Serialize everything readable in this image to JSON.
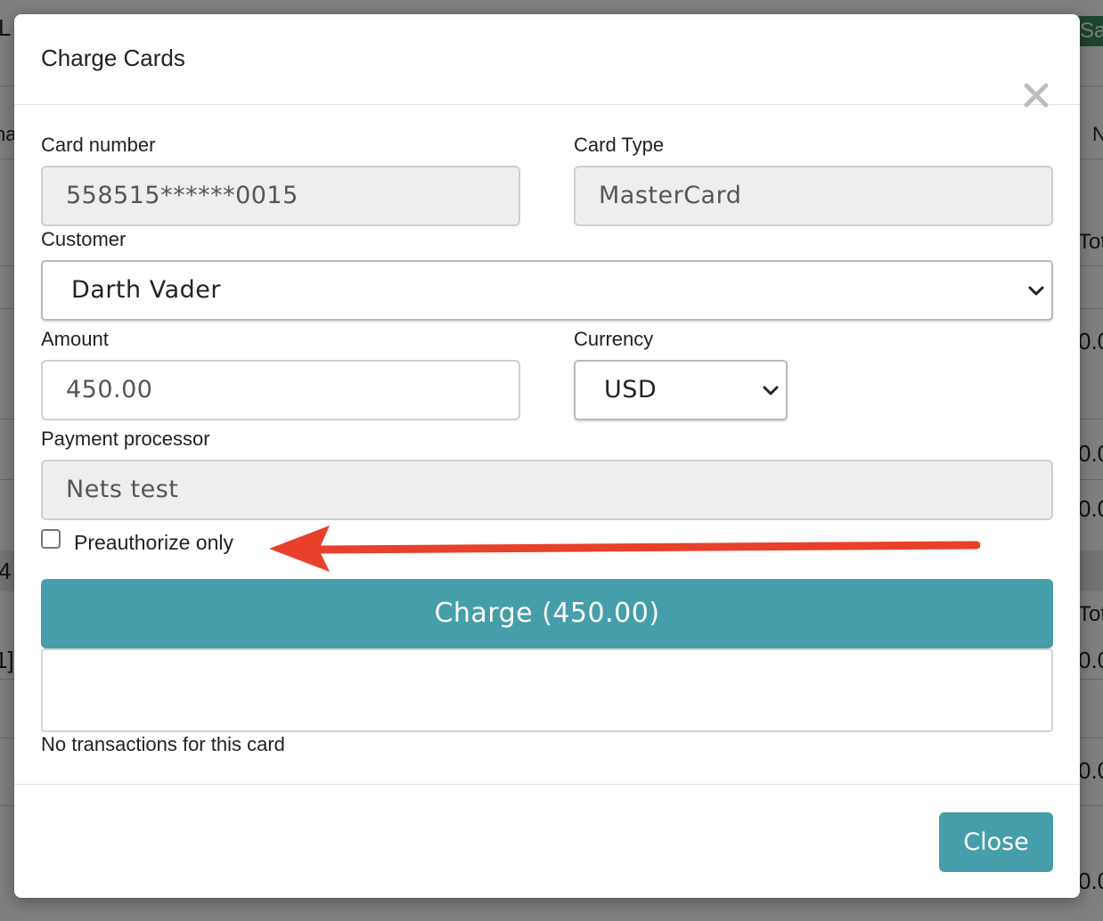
{
  "background": {
    "fragments": [
      "L",
      "na",
      "N",
      "Tot",
      "0.0",
      "0.0",
      "0.0",
      "4",
      "Tot",
      "1]",
      "0.0",
      "0.0",
      "0.0"
    ],
    "save_label": "Sav"
  },
  "modal": {
    "title": "Charge Cards",
    "close_icon": "close-x-icon",
    "card_number": {
      "label": "Card number",
      "value": "558515******0015"
    },
    "card_type": {
      "label": "Card Type",
      "value": "MasterCard"
    },
    "customer": {
      "label": "Customer",
      "selected": "Darth Vader"
    },
    "amount": {
      "label": "Amount",
      "value": "450.00"
    },
    "currency": {
      "label": "Currency",
      "selected": "USD"
    },
    "payment_processor": {
      "label": "Payment processor",
      "value": "Nets test"
    },
    "preauthorize": {
      "label": "Preauthorize only",
      "checked": false
    },
    "annotation": {
      "icon": "red-arrow-icon",
      "color": "#e8402a"
    },
    "charge_button": "Charge (450.00)",
    "transactions_empty": "No transactions for this card",
    "close_button": "Close"
  },
  "colors": {
    "accent": "#459ea9",
    "readonly_bg": "#eeeeee",
    "arrow": "#e8402a"
  }
}
